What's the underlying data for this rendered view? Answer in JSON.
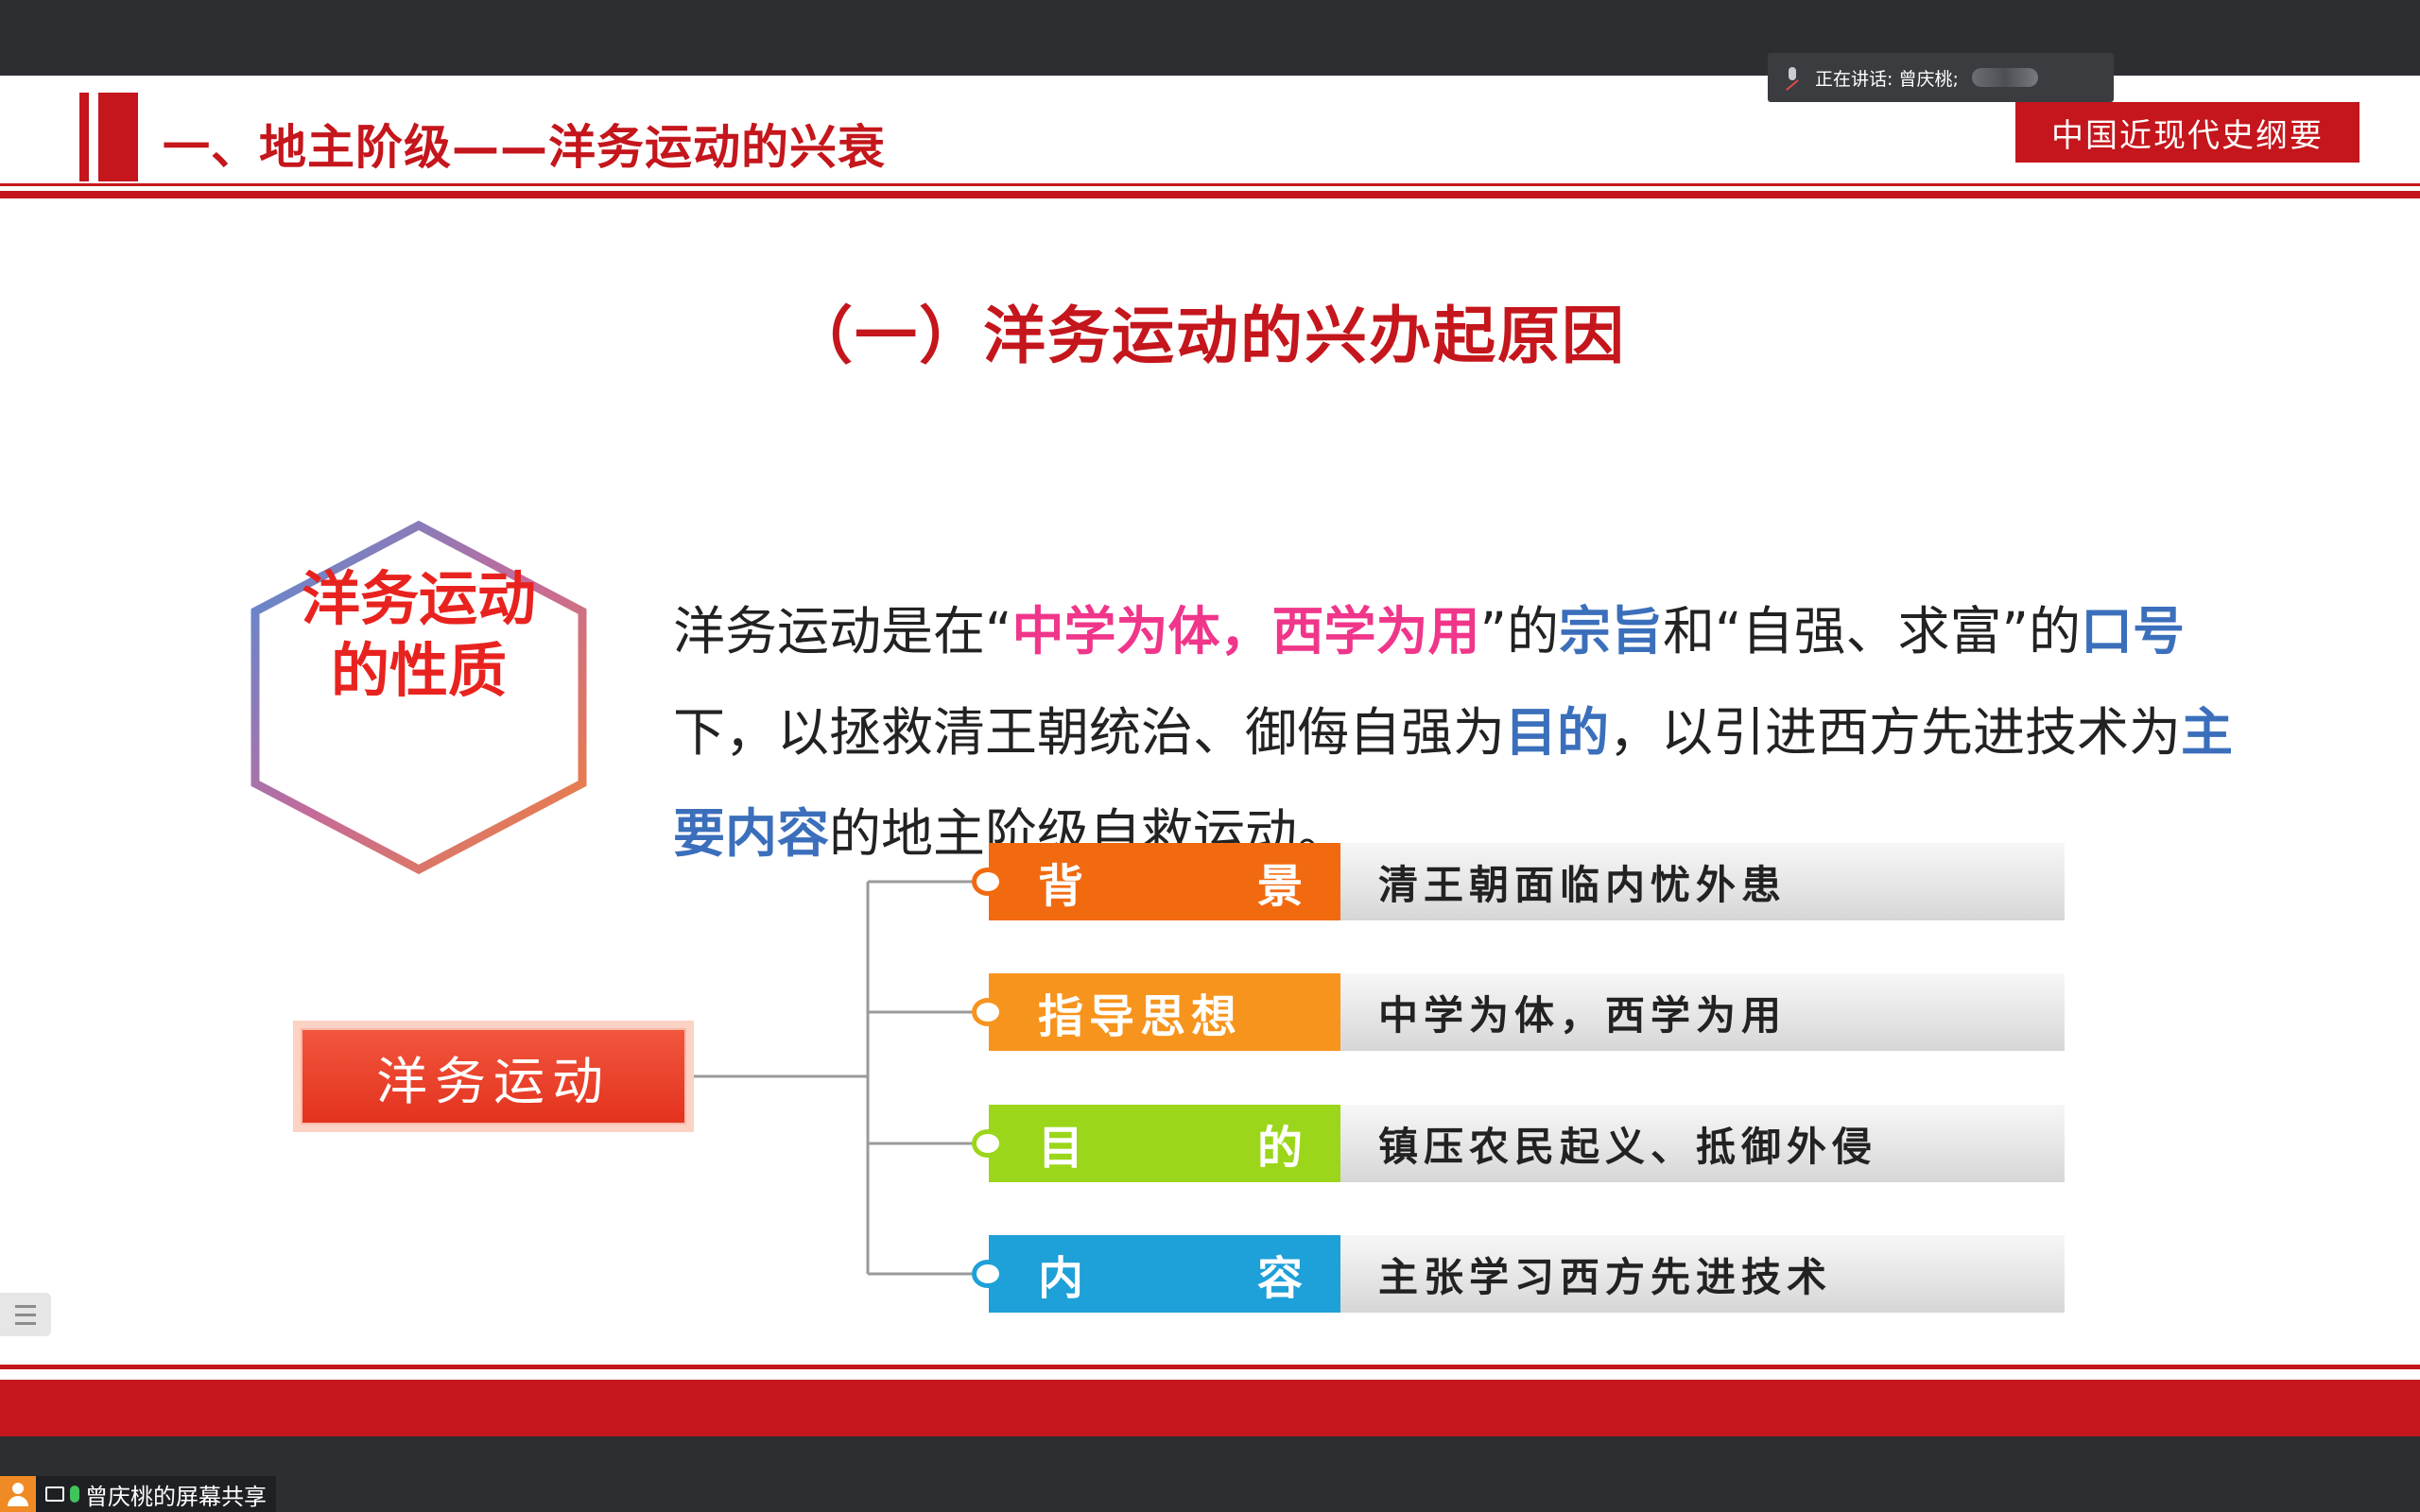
{
  "meeting": {
    "speaker_prefix": "正在讲话: 曾庆桃;",
    "share_label": "曾庆桃的屏幕共享"
  },
  "slide": {
    "section_title": "一、地主阶级——洋务运动的兴衰",
    "course_badge": "中国近现代史纲要",
    "sub_title": "（一）洋务运动的兴办起原因",
    "hexagon": {
      "line1": "洋务运动",
      "line2": "的性质"
    },
    "paragraph": [
      {
        "t": "洋务运动是在“",
        "s": ""
      },
      {
        "t": "中学为体，西学为用",
        "s": "pink"
      },
      {
        "t": "”的",
        "s": ""
      },
      {
        "t": "宗旨",
        "s": "blue"
      },
      {
        "t": "和“自强、求富”的",
        "s": ""
      },
      {
        "t": "口号",
        "s": "blue"
      },
      {
        "t": "下，以拯救清王朝统治、御侮自强为",
        "s": ""
      },
      {
        "t": "目的",
        "s": "blue"
      },
      {
        "t": "，以引进西方先进技术为",
        "s": ""
      },
      {
        "t": "主要内容",
        "s": "blue"
      },
      {
        "t": "的地主阶级自救运动。",
        "s": ""
      }
    ],
    "mindmap": {
      "root": "洋务运动",
      "branches": [
        {
          "l1": "背",
          "l2": "景",
          "value": "清王朝面临内忧外患",
          "color": "#f26a10"
        },
        {
          "l1": "指导思想",
          "l2": "",
          "value": "中学为体，西学为用",
          "color": "#f7941d"
        },
        {
          "l1": "目",
          "l2": "的",
          "value": "镇压农民起义、抵御外侵",
          "color": "#9bd61a"
        },
        {
          "l1": "内",
          "l2": "容",
          "value": "主张学习西方先进技术",
          "color": "#1ea0d8"
        }
      ]
    },
    "colors": {
      "brand_red": "#c4161c",
      "pink": "#f0368a",
      "blue": "#3b6fbb"
    }
  }
}
